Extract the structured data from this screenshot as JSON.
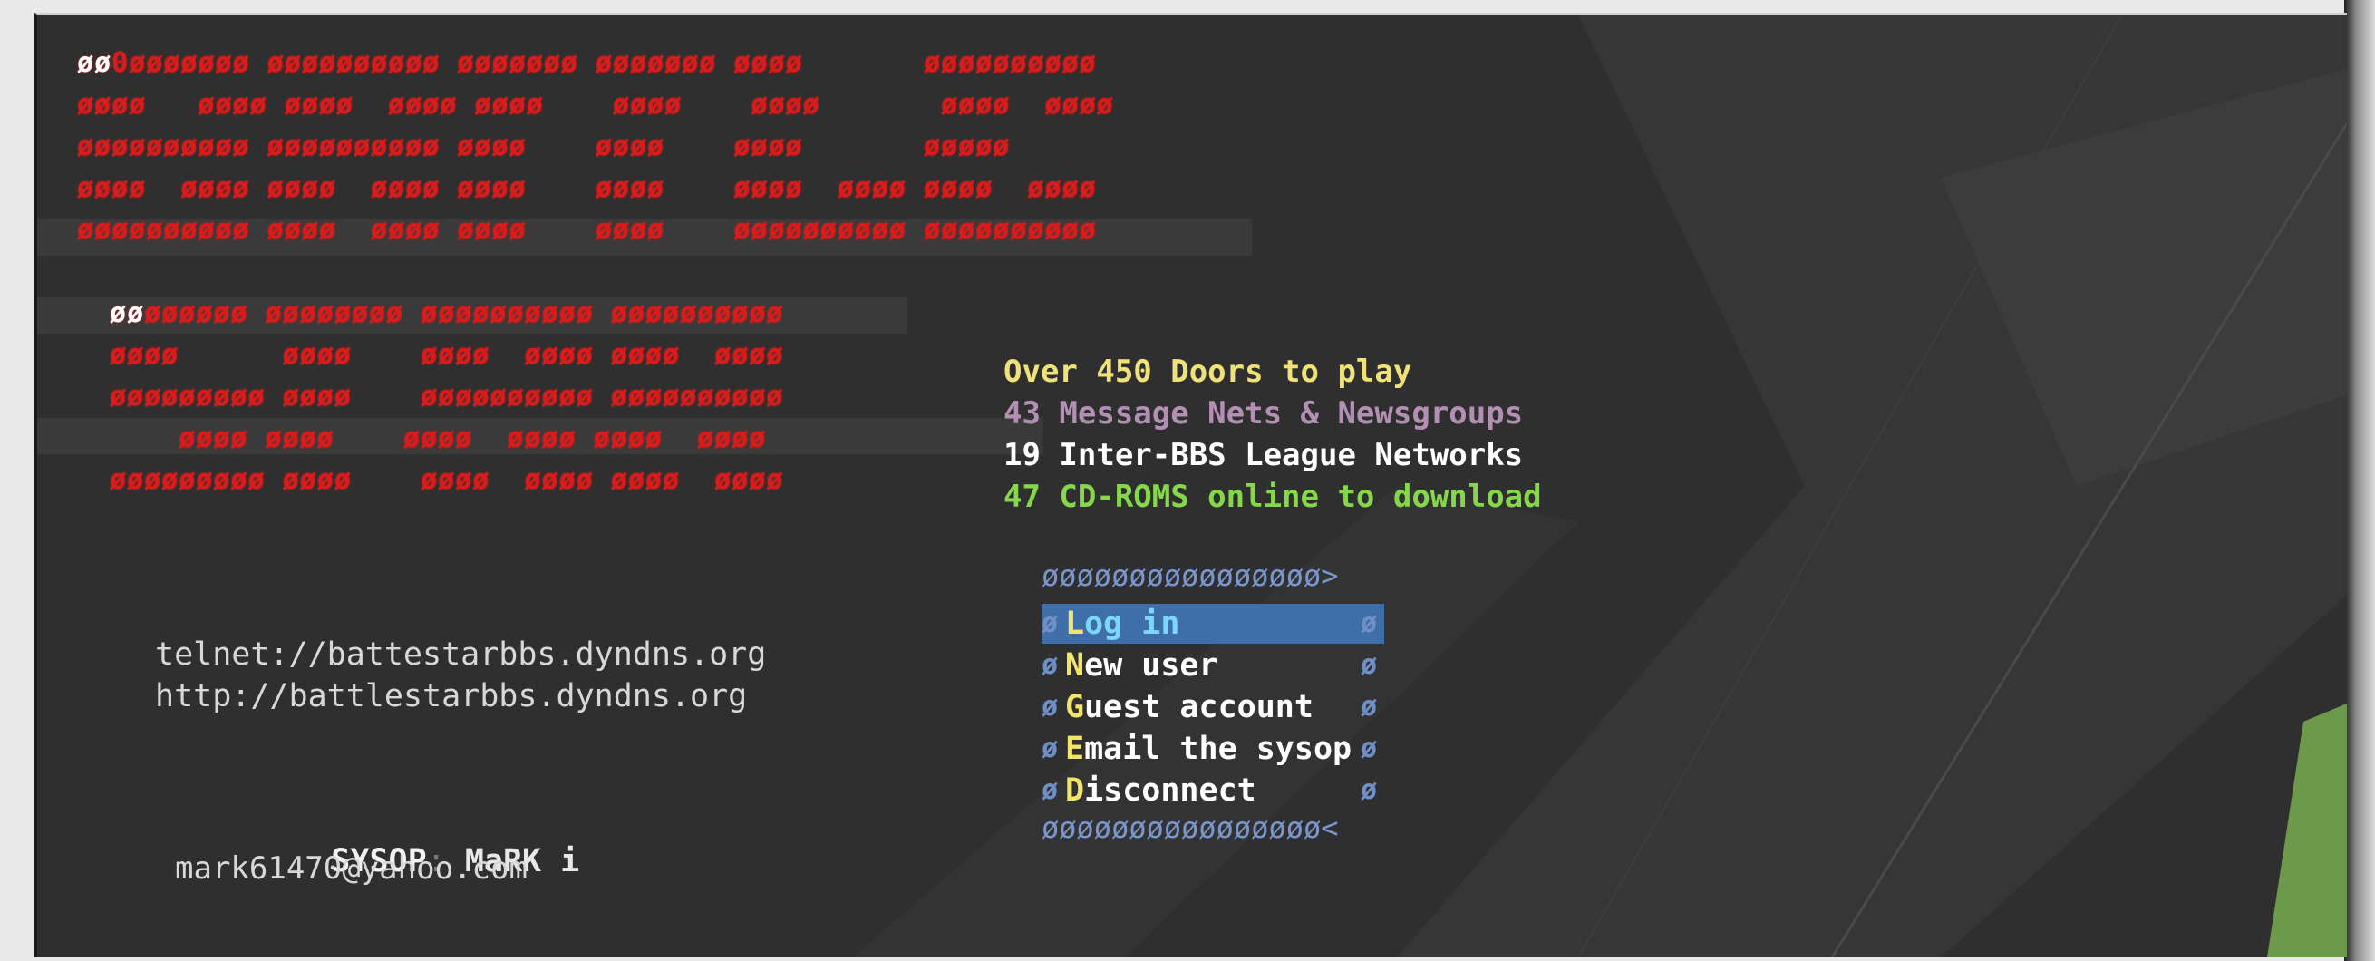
{
  "logo": {
    "rows_top": [
      "øø0øøøøøøø øøøøøøøøøø øøøøøøø øøøøøøø øøøø       øøøøøøøøøø",
      "øøøø   øøøø øøøø  øøøø øøøø    øøøø    øøøø       øøøø  øøøø",
      "øøøøøøøøøø øøøøøøøøøø øøøø    øøøø    øøøø       øøøøø",
      "øøøø  øøøø øøøø  øøøø øøøø    øøøø    øøøø  øøøø øøøø  øøøø",
      "øøøøøøøøøø øøøø  øøøø øøøø    øøøø    øøøøøøøøøø øøøøøøøøøø"
    ],
    "rows_bottom": [
      "øøøøøøøø øøøøøøøø øøøøøøøøøø øøøøøøøøøø",
      "øøøø      øøøø    øøøø  øøøø øøøø  øøøø",
      "øøøøøøøøø øøøø    øøøøøøøøøø øøøøøøøøøø",
      "    øøøø øøøø    øøøø  øøøø øøøø  øøøø",
      "øøøøøøøøø øøøø    øøøø  øøøø øøøø  øøøø"
    ],
    "red": "#d81c1c",
    "highlight_white": "#ffffff",
    "highlight_yellow": "#f0d020"
  },
  "features": [
    {
      "text": "Over 450 Doors to play",
      "color": "#f0e27a"
    },
    {
      "text": "43 Message Nets & Newsgroups",
      "color": "#b48fb4"
    },
    {
      "text": "19 Inter-BBS League Networks",
      "color": "#ffffff"
    },
    {
      "text": "47 CD-ROMS online to download",
      "color": "#86d84a"
    }
  ],
  "urls": {
    "telnet": "telnet://battestarbbs.dyndns.org",
    "http": "http://battlestarbbs.dyndns.org"
  },
  "sysop": {
    "label": "SYSOP",
    "separator": ":",
    "name": "MaRK i",
    "email": "mark61470@yahoo.com"
  },
  "menu": {
    "border_top": "øøøøøøøøøøøøøøøø>",
    "border_bottom": "øøøøøøøøøøøøøøøø<",
    "edge_glyph": "ø",
    "items": [
      {
        "hot": "L",
        "rest": "og in",
        "selected": true
      },
      {
        "hot": "N",
        "rest": "ew user",
        "selected": false
      },
      {
        "hot": "G",
        "rest": "uest account",
        "selected": false
      },
      {
        "hot": "E",
        "rest": "mail the sysop",
        "selected": false
      },
      {
        "hot": "D",
        "rest": "isconnect",
        "selected": false
      }
    ]
  },
  "colors": {
    "background": "#2f2f2f",
    "menu_selected": "#3f6fa8",
    "menu_border": "#6f8fc8"
  }
}
